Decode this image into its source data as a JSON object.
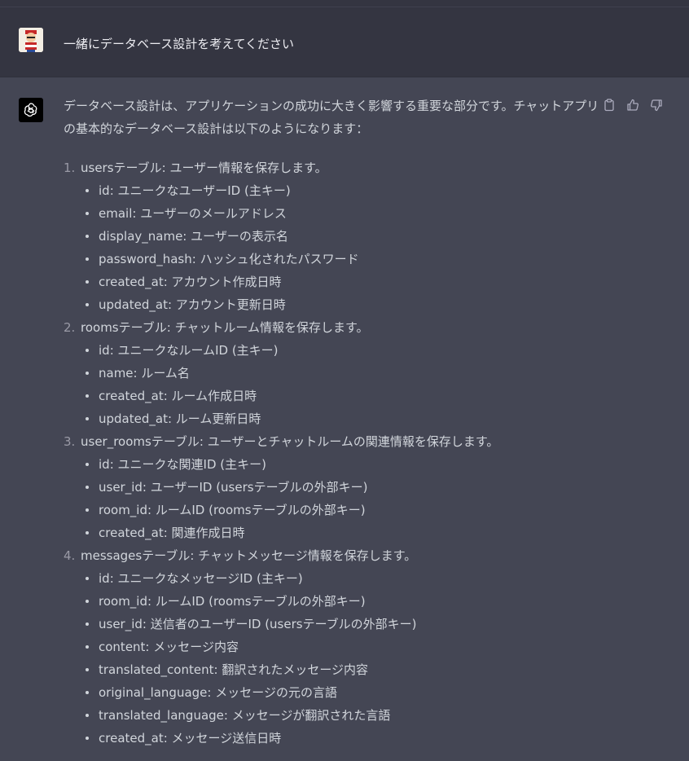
{
  "user_message": {
    "text": "一緒にデータベース設計を考えてください"
  },
  "assistant_message": {
    "intro": "データベース設計は、アプリケーションの成功に大きく影響する重要な部分です。チャットアプリの基本的なデータベース設計は以下のようになります：",
    "tables": [
      {
        "number": "1.",
        "name": "usersテーブル:",
        "desc": "ユーザー情報を保存します。",
        "fields": [
          {
            "key": "id:",
            "desc": "ユニークなユーザーID (主キー)"
          },
          {
            "key": "email:",
            "desc": "ユーザーのメールアドレス"
          },
          {
            "key": "display_name:",
            "desc": "ユーザーの表示名"
          },
          {
            "key": "password_hash:",
            "desc": "ハッシュ化されたパスワード"
          },
          {
            "key": "created_at:",
            "desc": "アカウント作成日時"
          },
          {
            "key": "updated_at:",
            "desc": "アカウント更新日時"
          }
        ]
      },
      {
        "number": "2.",
        "name": "roomsテーブル:",
        "desc": "チャットルーム情報を保存します。",
        "fields": [
          {
            "key": "id:",
            "desc": "ユニークなルームID (主キー)"
          },
          {
            "key": "name:",
            "desc": "ルーム名"
          },
          {
            "key": "created_at:",
            "desc": "ルーム作成日時"
          },
          {
            "key": "updated_at:",
            "desc": "ルーム更新日時"
          }
        ]
      },
      {
        "number": "3.",
        "name": "user_roomsテーブル:",
        "desc": "ユーザーとチャットルームの関連情報を保存します。",
        "fields": [
          {
            "key": "id:",
            "desc": "ユニークな関連ID (主キー)"
          },
          {
            "key": "user_id:",
            "desc": "ユーザーID (usersテーブルの外部キー)"
          },
          {
            "key": "room_id:",
            "desc": "ルームID (roomsテーブルの外部キー)"
          },
          {
            "key": "created_at:",
            "desc": "関連作成日時"
          }
        ]
      },
      {
        "number": "4.",
        "name": "messagesテーブル:",
        "desc": "チャットメッセージ情報を保存します。",
        "fields": [
          {
            "key": "id:",
            "desc": "ユニークなメッセージID (主キー)"
          },
          {
            "key": "room_id:",
            "desc": "ルームID (roomsテーブルの外部キー)"
          },
          {
            "key": "user_id:",
            "desc": "送信者のユーザーID (usersテーブルの外部キー)"
          },
          {
            "key": "content:",
            "desc": "メッセージ内容"
          },
          {
            "key": "translated_content:",
            "desc": "翻訳されたメッセージ内容"
          },
          {
            "key": "original_language:",
            "desc": "メッセージの元の言語"
          },
          {
            "key": "translated_language:",
            "desc": "メッセージが翻訳された言語"
          },
          {
            "key": "created_at:",
            "desc": "メッセージ送信日時"
          }
        ]
      }
    ]
  },
  "icons": {
    "copy": "clipboard-icon",
    "like": "thumbs-up-icon",
    "dislike": "thumbs-down-icon",
    "bot_avatar": "openai-logo-icon"
  },
  "colors": {
    "assistant_bg": "#444654",
    "user_bg": "#343541",
    "text": "#d1d5db"
  }
}
